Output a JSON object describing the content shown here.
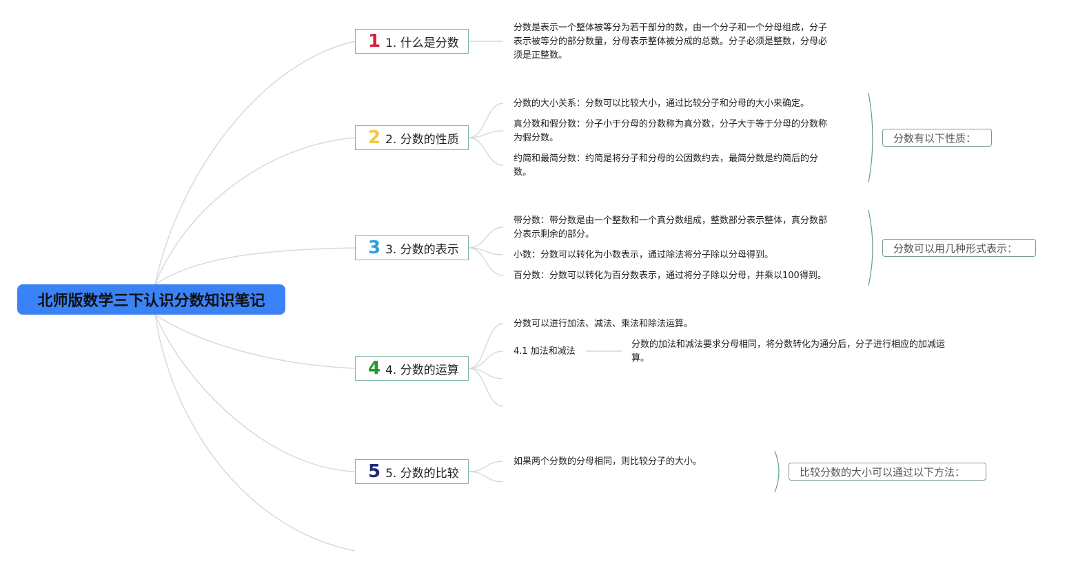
{
  "root": {
    "title": "北师版数学三下认识分数知识笔记"
  },
  "topics": [
    {
      "num": "1",
      "label": "1. 什么是分数",
      "color": "#d81f3a"
    },
    {
      "num": "2",
      "label": "2. 分数的性质",
      "color": "#f2c83c"
    },
    {
      "num": "3",
      "label": "3. 分数的表示",
      "color": "#2a9de0"
    },
    {
      "num": "4",
      "label": "4. 分数的运算",
      "color": "#1f9a2e"
    },
    {
      "num": "5",
      "label": "5. 分数的比较",
      "color": "#1c2a7a"
    }
  ],
  "notes": {
    "t1": {
      "l1": "分数是表示一个整体被等分为若干部分的数，由一个分子和一个分母组成，分子",
      "l2": "表示被等分的部分数量，分母表示整体被分成的总数。分子必须是整数，分母必",
      "l3": "须是正整数。"
    },
    "t2a": "分数的大小关系：分数可以比较大小，通过比较分子和分母的大小来确定。",
    "t2b": {
      "l1": "真分数和假分数：分子小于分母的分数称为真分数，分子大于等于分母的分数称",
      "l2": "为假分数。"
    },
    "t2c": {
      "l1": "约简和最简分数：约简是将分子和分母的公因数约去，最简分数是约简后的分",
      "l2": "数。"
    },
    "t3a": {
      "l1": "带分数：带分数是由一个整数和一个真分数组成，整数部分表示整体，真分数部",
      "l2": "分表示剩余的部分。"
    },
    "t3b": "小数：分数可以转化为小数表示，通过除法将分子除以分母得到。",
    "t3c": "百分数：分数可以转化为百分数表示，通过将分子除以分母，并乘以100得到。",
    "t4a": "分数可以进行加法、减法、乘法和除法运算。",
    "t4b_label": "4.1 加法和减法",
    "t4b_detail": {
      "l1": "分数的加法和减法要求分母相同，将分数转化为通分后，分子进行相应的加减运",
      "l2": "算。"
    },
    "t5a": "如果两个分数的分母相同，则比较分子的大小。"
  },
  "summaries": {
    "s2": "分数有以下性质：",
    "s3": "分数可以用几种形式表示：",
    "s5": "比较分数的大小可以通过以下方法："
  },
  "colors": {
    "root_fill": "#3b82f6",
    "topic_border": "#7fb6a6",
    "connector": "#d9d9d9",
    "summary_bracket": "#5f9e88"
  }
}
